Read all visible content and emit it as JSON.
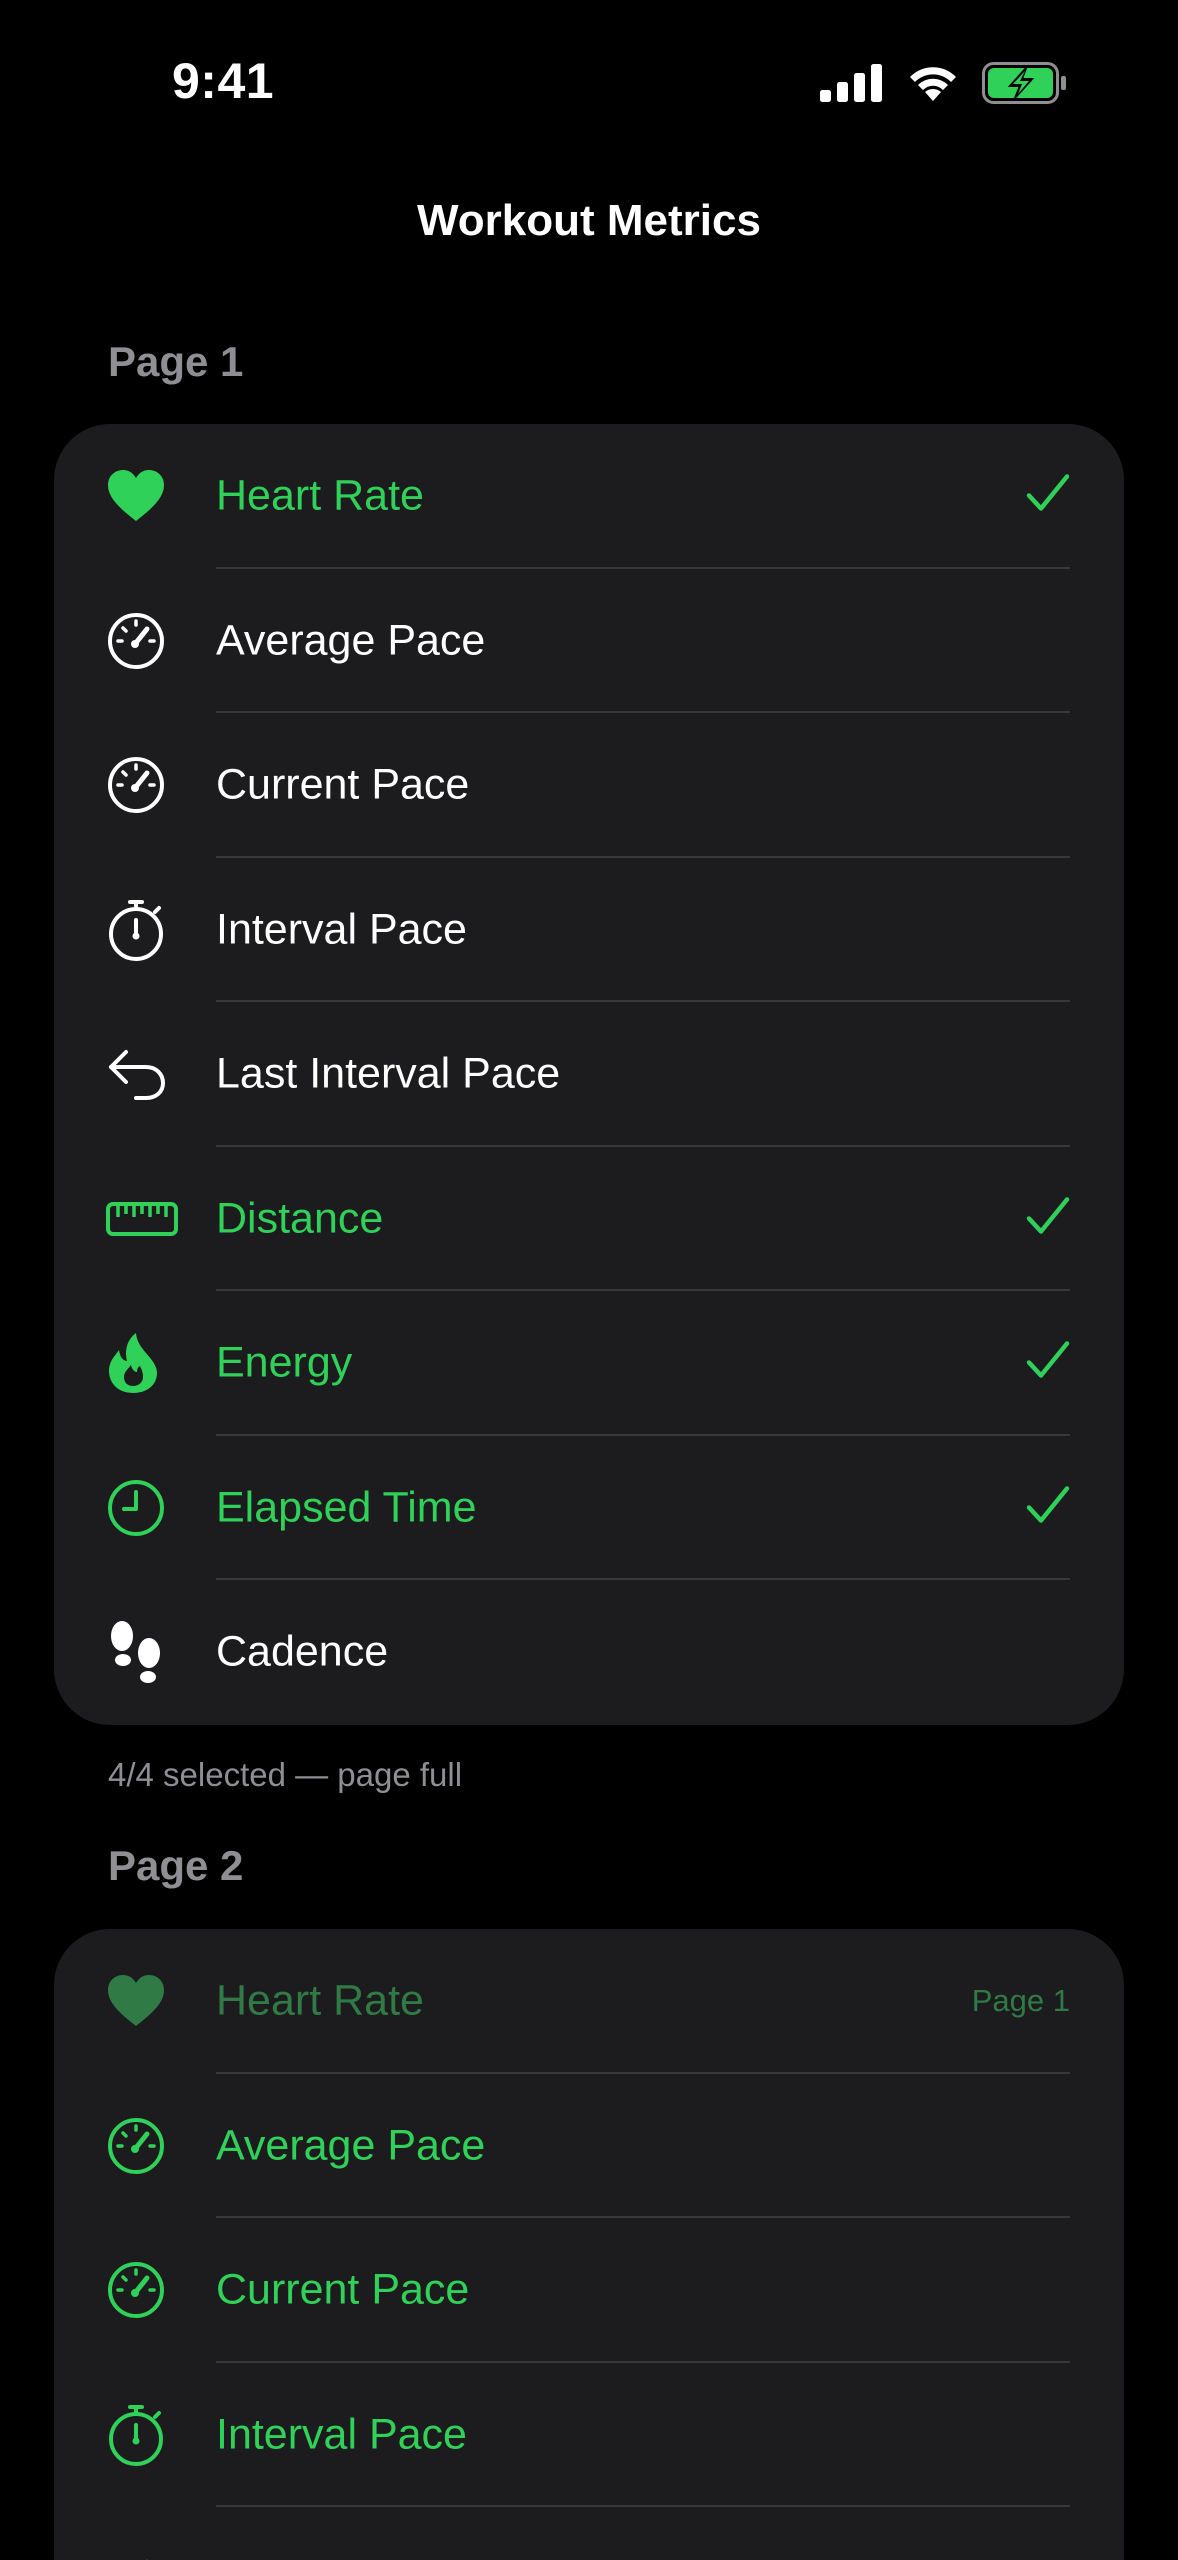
{
  "status": {
    "time": "9:41"
  },
  "nav": {
    "title": "Workout Metrics"
  },
  "colors": {
    "accent": "#30d158",
    "dimmed": "#2f7a45",
    "card": "#1c1c1e",
    "separator": "#38383a",
    "secondary_text": "#8e8e93"
  },
  "page1": {
    "header": "Page 1",
    "footer": "4/4 selected — page full",
    "items": [
      {
        "label": "Heart Rate",
        "icon": "heart-icon",
        "selected": true
      },
      {
        "label": "Average Pace",
        "icon": "speedometer-icon",
        "selected": false
      },
      {
        "label": "Current Pace",
        "icon": "speedometer-icon",
        "selected": false
      },
      {
        "label": "Interval Pace",
        "icon": "stopwatch-icon",
        "selected": false
      },
      {
        "label": "Last Interval Pace",
        "icon": "return-arrow-icon",
        "selected": false
      },
      {
        "label": "Distance",
        "icon": "ruler-icon",
        "selected": true
      },
      {
        "label": "Energy",
        "icon": "flame-icon",
        "selected": true
      },
      {
        "label": "Elapsed Time",
        "icon": "clock-icon",
        "selected": true
      },
      {
        "label": "Cadence",
        "icon": "footprints-icon",
        "selected": false
      }
    ]
  },
  "page2": {
    "header": "Page 2",
    "items": [
      {
        "label": "Heart Rate",
        "icon": "heart-icon",
        "tag": "Page 1"
      },
      {
        "label": "Average Pace",
        "icon": "speedometer-icon"
      },
      {
        "label": "Current Pace",
        "icon": "speedometer-icon"
      },
      {
        "label": "Interval Pace",
        "icon": "stopwatch-icon"
      }
    ]
  }
}
